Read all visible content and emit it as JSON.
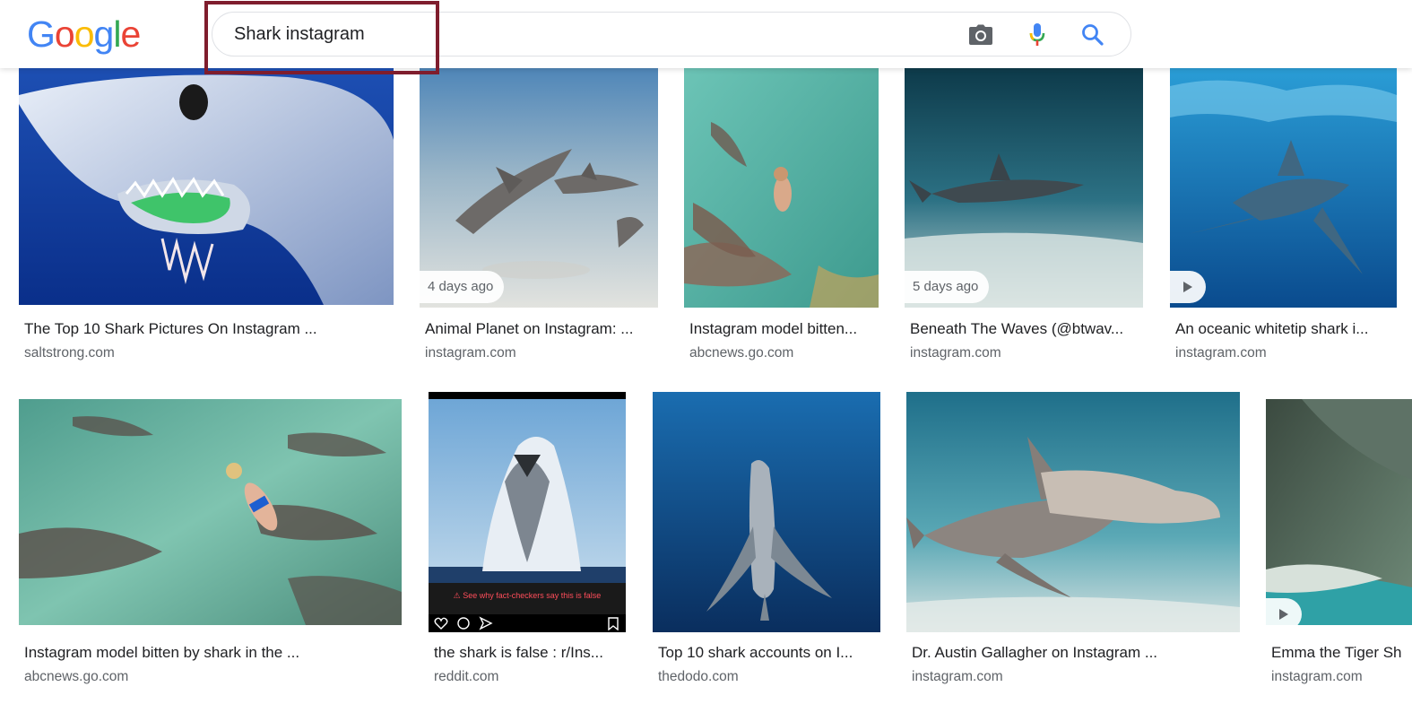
{
  "header": {
    "logo_letters": [
      {
        "char": "G",
        "color": "#4285F4"
      },
      {
        "char": "o",
        "color": "#EA4335"
      },
      {
        "char": "o",
        "color": "#FBBC05"
      },
      {
        "char": "g",
        "color": "#4285F4"
      },
      {
        "char": "l",
        "color": "#34A853"
      },
      {
        "char": "e",
        "color": "#EA4335"
      }
    ],
    "search_value": "Shark instagram",
    "icons": [
      "camera-icon",
      "microphone-icon",
      "search-icon"
    ]
  },
  "results": [
    {
      "title": "The Top 10 Shark Pictures On Instagram ...",
      "source": "saltstrong.com",
      "badge": "",
      "play": false
    },
    {
      "title": "Animal Planet on Instagram: ...",
      "source": "instagram.com",
      "badge": "4 days ago",
      "play": false
    },
    {
      "title": "Instagram model bitten...",
      "source": "abcnews.go.com",
      "badge": "",
      "play": false
    },
    {
      "title": "Beneath The Waves (@btwav...",
      "source": "instagram.com",
      "badge": "5 days ago",
      "play": false
    },
    {
      "title": "An oceanic whitetip shark i...",
      "source": "instagram.com",
      "badge": "",
      "play": true
    },
    {
      "title": "Instagram model bitten by shark in the ...",
      "source": "abcnews.go.com",
      "badge": "",
      "play": false
    },
    {
      "title": "the shark is false : r/Ins...",
      "source": "reddit.com",
      "badge": "",
      "play": false
    },
    {
      "title": "Top 10 shark accounts on I...",
      "source": "thedodo.com",
      "badge": "",
      "play": false
    },
    {
      "title": "Dr. Austin Gallagher on Instagram ...",
      "source": "instagram.com",
      "badge": "",
      "play": false
    },
    {
      "title": "Emma the Tiger Sh",
      "source": "instagram.com",
      "badge": "",
      "play": true
    }
  ],
  "reddit_overlay": {
    "warning": "See why fact-checkers say this is false"
  },
  "colors": {
    "highlight_border": "#7f1d2d",
    "ocean_deep": "#0f3f86",
    "ocean_teal": "#4fb3a8"
  }
}
